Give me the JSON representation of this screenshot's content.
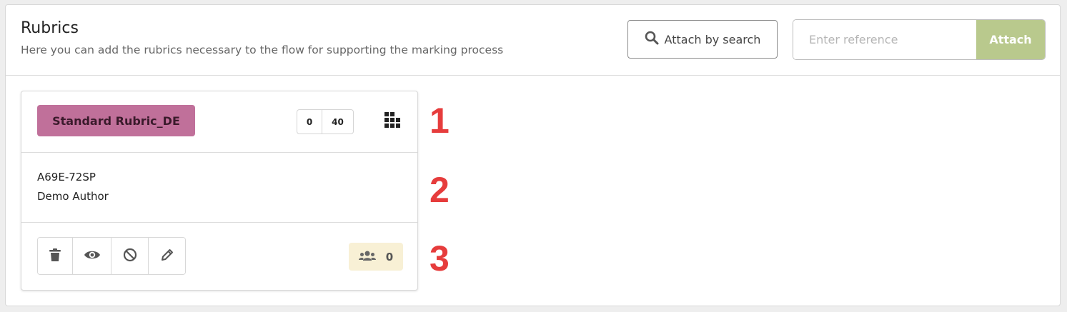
{
  "header": {
    "title": "Rubrics",
    "subtitle": "Here you can add the rubrics necessary to the flow for supporting the marking process",
    "search_button_label": "Attach by search",
    "search_button_icon": "search-icon",
    "reference_placeholder": "Enter reference",
    "reference_value": "",
    "attach_button_label": "Attach"
  },
  "rubric_card": {
    "name": "Standard Rubric_DE",
    "score_min": "0",
    "score_max": "40",
    "grid_icon": "grid-icon",
    "reference": "A69E-72SP",
    "author": "Demo Author",
    "actions": [
      "trash-icon",
      "eye-icon",
      "ban-icon",
      "pencil-icon"
    ],
    "users_icon": "users-icon",
    "users_count": "0"
  },
  "annotations": [
    "1",
    "2",
    "3"
  ],
  "colors": {
    "rubric_badge": "#c0709a",
    "attach_button": "#b9c98d",
    "users_badge": "#f8f0d5",
    "annotation": "#e63c3c"
  }
}
